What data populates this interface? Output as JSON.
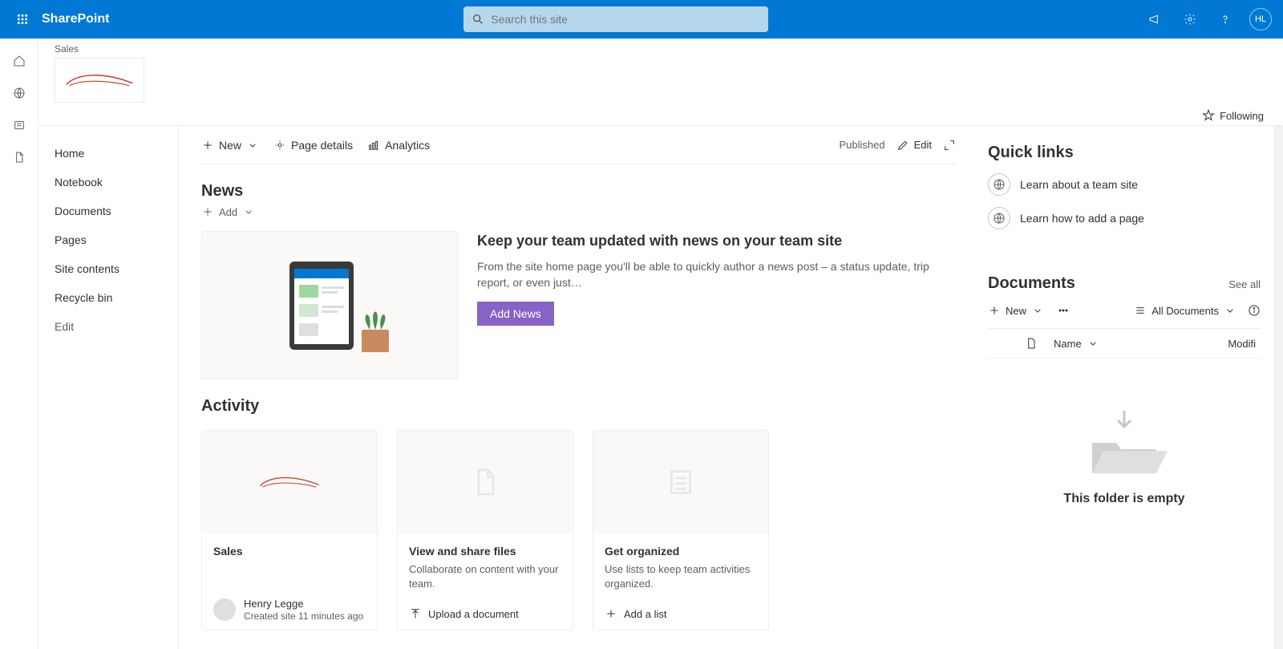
{
  "top": {
    "product": "SharePoint",
    "search_placeholder": "Search this site",
    "avatar_initials": "HL"
  },
  "site": {
    "breadcrumb": "Sales",
    "following_label": "Following"
  },
  "nav": {
    "items": [
      "Home",
      "Notebook",
      "Documents",
      "Pages",
      "Site contents",
      "Recycle bin",
      "Edit"
    ]
  },
  "cmdbar": {
    "new": "New",
    "page_details": "Page details",
    "analytics": "Analytics",
    "published": "Published",
    "edit": "Edit"
  },
  "news": {
    "title": "News",
    "add": "Add",
    "headline": "Keep your team updated with news on your team site",
    "body": "From the site home page you'll be able to quickly author a news post – a status update, trip report, or even just…",
    "add_news_btn": "Add News"
  },
  "activity": {
    "title": "Activity",
    "cards": [
      {
        "title": "Sales",
        "desc": "",
        "person_name": "Henry Legge",
        "person_sub": "Created site 11 minutes ago"
      },
      {
        "title": "View and share files",
        "desc": "Collaborate on content with your team.",
        "action": "Upload a document"
      },
      {
        "title": "Get organized",
        "desc": "Use lists to keep team activities organized.",
        "action": "Add a list"
      }
    ]
  },
  "quicklinks": {
    "title": "Quick links",
    "items": [
      "Learn about a team site",
      "Learn how to add a page"
    ]
  },
  "documents": {
    "title": "Documents",
    "see_all": "See all",
    "new": "New",
    "view": "All Documents",
    "col_name": "Name",
    "col_modified": "Modifi",
    "empty": "This folder is empty"
  }
}
